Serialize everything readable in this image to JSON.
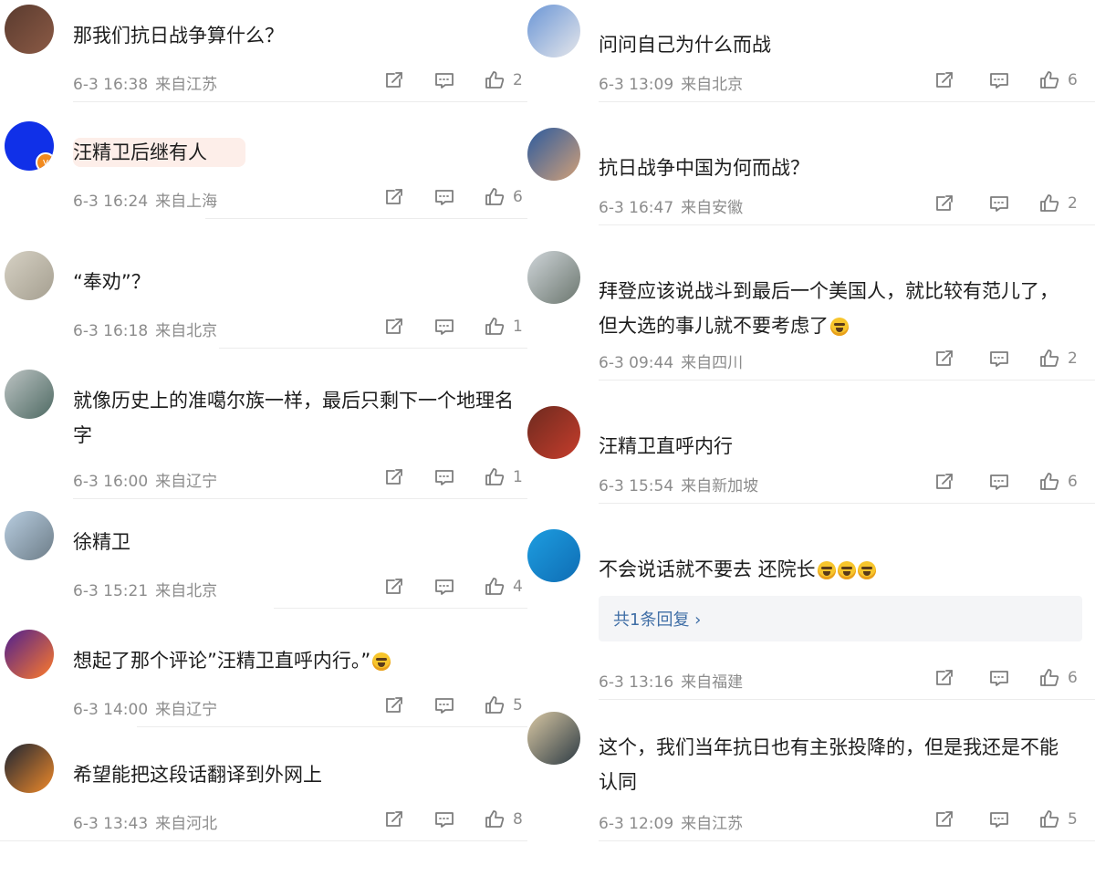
{
  "left_comments": [
    {
      "text": "那我们抗日战争算什么？",
      "date": "6-3 16:38",
      "location": "来自江苏",
      "likes": "2",
      "avatar_colors": [
        "#5a3b2f",
        "#8b5a45"
      ]
    },
    {
      "text": "汪精卫后继有人",
      "date": "6-3 16:24",
      "location": "来自上海",
      "likes": "6",
      "avatar_colors": [
        "#1030e8",
        "#1030e8"
      ],
      "verified": true
    },
    {
      "text": "“奉劝”？",
      "date": "6-3 16:18",
      "location": "来自北京",
      "likes": "1",
      "avatar_colors": [
        "#d6d1c4",
        "#a59f90"
      ]
    },
    {
      "text": "就像历史上的准噶尔族一样，最后只剩下一个地理名字",
      "date": "6-3 16:00",
      "location": "来自辽宁",
      "likes": "1",
      "avatar_colors": [
        "#bcc3c3",
        "#4e6a63"
      ]
    },
    {
      "text": "徐精卫",
      "date": "6-3 15:21",
      "location": "来自北京",
      "likes": "4",
      "avatar_colors": [
        "#b8cde0",
        "#6d7d88"
      ]
    },
    {
      "text": "想起了那个评论”汪精卫直呼内行。”",
      "date": "6-3 14:00",
      "location": "来自辽宁",
      "likes": "5",
      "avatar_colors": [
        "#4e1f8f",
        "#ff7b2a"
      ],
      "emoji": true
    },
    {
      "text": "希望能把这段话翻译到外网上",
      "date": "6-3 13:43",
      "location": "来自河北",
      "likes": "8",
      "avatar_colors": [
        "#1c2433",
        "#f08a2a"
      ]
    }
  ],
  "right_comments": [
    {
      "text": "问问自己为什么而战",
      "date": "6-3 13:09",
      "location": "来自北京",
      "likes": "6",
      "avatar_colors": [
        "#6b96d6",
        "#e5e6ea"
      ]
    },
    {
      "text": "抗日战争中国为何而战？",
      "date": "6-3 16:47",
      "location": "来自安徽",
      "likes": "2",
      "avatar_colors": [
        "#2b5a9e",
        "#d2a078"
      ]
    },
    {
      "text": "拜登应该说战斗到最后一个美国人，就比较有范儿了，但大选的事儿就不要考虑了",
      "date": "6-3 09:44",
      "location": "来自四川",
      "likes": "2",
      "avatar_colors": [
        "#cfd5d9",
        "#6c776f"
      ],
      "emoji": true
    },
    {
      "text": "汪精卫直呼内行",
      "date": "6-3 15:54",
      "location": "来自新加坡",
      "likes": "6",
      "avatar_colors": [
        "#6d2a1f",
        "#c63d2c"
      ]
    },
    {
      "text": "不会说话就不要去 还院长",
      "date": "6-3 13:16",
      "location": "来自福建",
      "likes": "6",
      "avatar_colors": [
        "#1d9de0",
        "#0f6db4"
      ],
      "emoji3": true,
      "reply": "共1条回复 ›"
    },
    {
      "text": "这个，我们当年抗日也有主张投降的，但是我还是不能认同",
      "date": "6-3 12:09",
      "location": "来自江苏",
      "likes": "5",
      "avatar_colors": [
        "#d8c7a3",
        "#2d3b44"
      ]
    }
  ],
  "icons": {
    "share": "share-icon",
    "comment": "comment-icon",
    "like": "like-icon"
  }
}
